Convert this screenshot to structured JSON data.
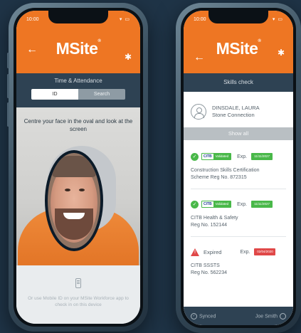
{
  "left_phone": {
    "status_time": "10:00",
    "status_icons": "▾ ▭",
    "back_icon": "←",
    "logo": "MSite",
    "logo_mark": "®",
    "settings_icon": "✱",
    "subtitle": "Time & Attendance",
    "tabs": [
      {
        "label": "ID",
        "active": true
      },
      {
        "label": "Search",
        "active": false
      }
    ],
    "instruction": "Centre your face in the oval and look at the screen",
    "mobile_id_text": "Or use Mobile ID on your MSite Workforce app to check in on this device"
  },
  "right_phone": {
    "status_time": "10:00",
    "status_icons": "▾ ▭",
    "back_icon": "←",
    "logo": "MSite",
    "logo_mark": "®",
    "settings_icon": "✱",
    "subtitle": "Skills check",
    "profile": {
      "name": "DINSDALE, LAURA",
      "company": "Stone Connection"
    },
    "show_all_label": "Show all",
    "records": [
      {
        "status": "valid",
        "badge_brand": "CITB",
        "badge_status": "Validated",
        "exp_label": "Exp.",
        "exp_date": "11/11/2027",
        "title_line1": "Construction Skills Certification",
        "title_line2": "Scheme Reg No. 872315"
      },
      {
        "status": "valid",
        "badge_brand": "CITB",
        "badge_status": "Validated",
        "exp_label": "Exp.",
        "exp_date": "11/11/2027",
        "title_line1": "CITB Health & Safety",
        "title_line2": "Reg No. 152144"
      },
      {
        "status": "expired",
        "status_label": "Expired",
        "exp_label": "Exp.",
        "exp_date": "02/04/2020",
        "title_line1": "CITB SSSTS",
        "title_line2": "Reg No. 562234"
      }
    ],
    "footer": {
      "synced_label": "Synced",
      "user_name": "Joe Smith"
    }
  },
  "colors": {
    "brand_orange": "#ee7623",
    "navy": "#2e4253",
    "valid_green": "#49b849",
    "expired_red": "#e04848"
  }
}
